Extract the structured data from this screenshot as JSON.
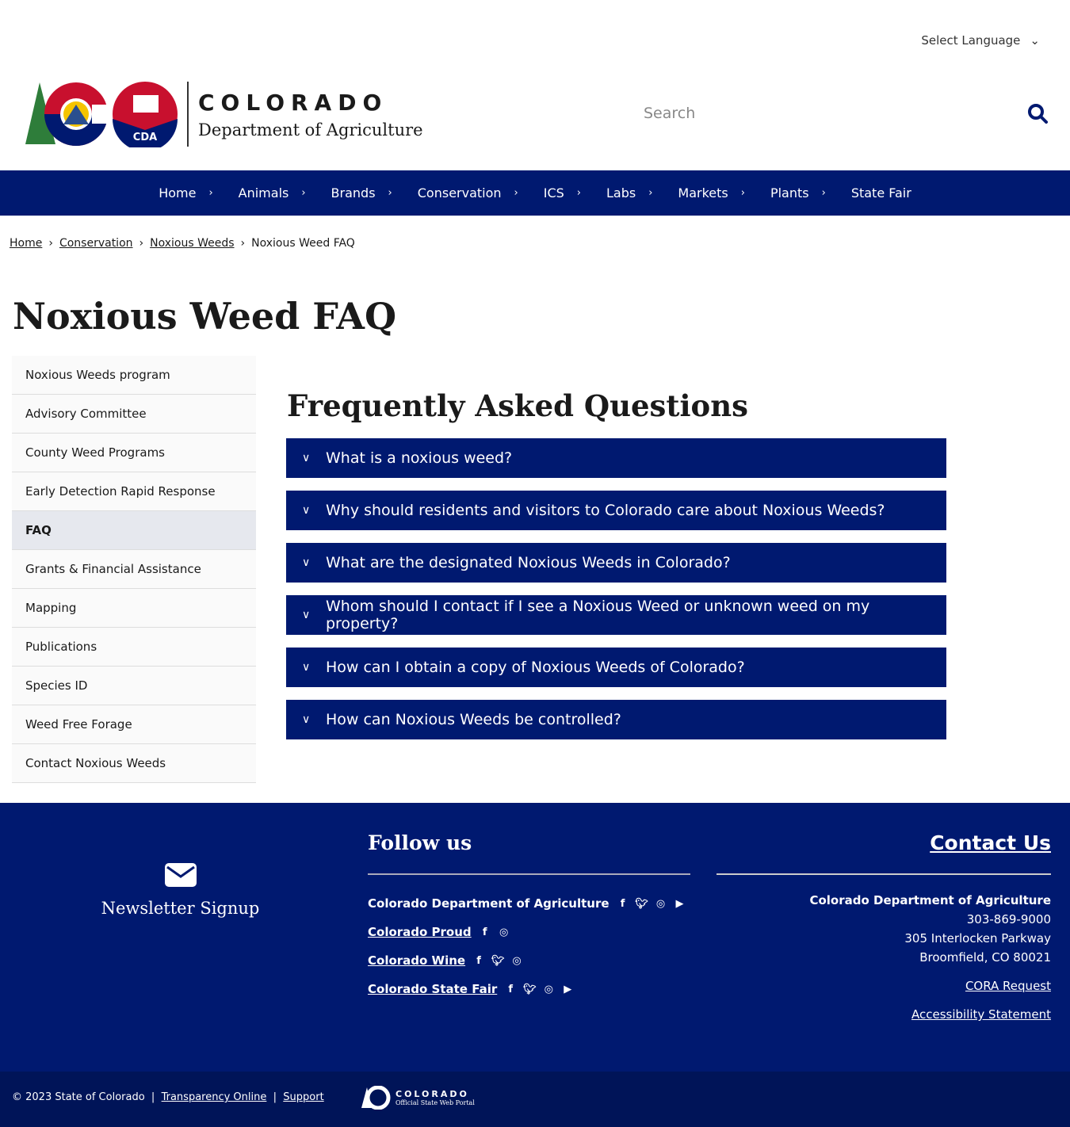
{
  "header": {
    "language_select": "Select Language",
    "logo_line1": "COLORADO",
    "logo_line2": "Department of Agriculture",
    "logo_badge": "CDA",
    "search_placeholder": "Search"
  },
  "nav": [
    "Home",
    "Animals",
    "Brands",
    "Conservation",
    "ICS",
    "Labs",
    "Markets",
    "Plants",
    "State Fair"
  ],
  "breadcrumb": [
    "Home",
    "Conservation",
    "Noxious Weeds",
    "Noxious Weed FAQ"
  ],
  "page_title": "Noxious Weed FAQ",
  "sidebar": {
    "active": "FAQ",
    "items": [
      "Noxious Weeds program",
      "Advisory Committee",
      "County Weed Programs",
      "Early Detection Rapid Response",
      "FAQ",
      "Grants & Financial Assistance",
      "Mapping",
      "Publications",
      "Species ID",
      "Weed Free Forage",
      "Contact Noxious Weeds"
    ]
  },
  "faq": {
    "heading": "Frequently Asked Questions",
    "questions": [
      "What is a noxious weed?",
      "Why should residents and visitors to Colorado care about Noxious Weeds?",
      "What are the designated Noxious Weeds in Colorado?",
      "Whom should I contact if I see a Noxious Weed or unknown weed on my property?",
      "How can I obtain a copy of Noxious Weeds of Colorado?",
      "How can Noxious Weeds be controlled?"
    ]
  },
  "footer": {
    "newsletter": "Newsletter Signup",
    "follow_heading": "Follow us",
    "follow": [
      {
        "label": "Colorado Department of Agriculture",
        "icons": [
          "facebook",
          "twitter",
          "instagram",
          "youtube"
        ]
      },
      {
        "label": "Colorado Proud",
        "icons": [
          "facebook",
          "instagram"
        ]
      },
      {
        "label": "Colorado Wine",
        "icons": [
          "facebook",
          "twitter",
          "instagram"
        ]
      },
      {
        "label": "Colorado State Fair",
        "icons": [
          "facebook",
          "twitter",
          "instagram",
          "youtube"
        ]
      }
    ],
    "contact_heading": "Contact Us",
    "org": "Colorado Department of Agriculture",
    "phone": "303-869-9000",
    "address1": "305 Interlocken Parkway",
    "address2": "Broomfield, CO 80021",
    "cora": "CORA Request",
    "accessibility": "Accessibility Statement"
  },
  "bottom": {
    "copyright": "© 2023 State of Colorado",
    "transparency": "Transparency Online",
    "support": "Support",
    "portal1": "COLORADO",
    "portal2": "Official State Web Portal"
  },
  "colors": {
    "navy": "#001970",
    "bottom": "#001458"
  }
}
